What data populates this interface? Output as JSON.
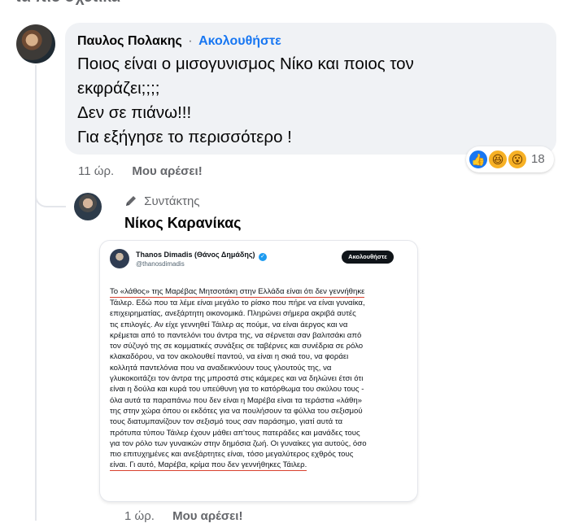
{
  "top_cut_text": "τα πιο σχετικά",
  "comment1": {
    "author": "Παυλος Πολακης",
    "separator": "·",
    "follow_label": "Ακολουθήστε",
    "lines": [
      "Ποιος είναι ο μισογυνισμος Νίκο και ποιος τον",
      "εκφράζει;;;;",
      "Δεν σε πιάνω!!!",
      "Για εξήγησε το περισσότερο !"
    ],
    "reactions": {
      "icons": [
        "like-reaction",
        "haha-reaction",
        "wow-reaction"
      ],
      "count": "18"
    },
    "time": "11 ώρ.",
    "like_label": "Μου αρέσει!"
  },
  "reply": {
    "role": "Συντάκτης",
    "author": "Νίκος Καρανίκας",
    "time": "1 ώρ.",
    "like_label": "Μου αρέσει!",
    "tweet": {
      "name": "Thanos Dimadis (Θάνος Δημάδης)",
      "handle": "@thanosdimadis",
      "follow_label": "Ακολουθήστε",
      "lines": [
        "Το «λάθος» της Μαρέβας Μητσοτάκη στην Ελλάδα είναι ότι δεν γεννήθηκε",
        "Τάιλερ. Εδώ που τα λέμε είναι μεγάλο το ρίσκο που πήρε να είναι γυναίκα,",
        "επιχειρηματίας, ανεξάρτητη οικονομικά. Πληρώνει σήμερα ακριβά αυτές",
        "τις επιλογές. Αν είχε γεννηθεί Τάιλερ ας πούμε, να είναι άεργος και να",
        "κρέμεται από το παντελόνι του άντρα της, να σέρνεται σαν βαλιτσάκι από",
        "τον σύζυγό της σε κομματικές συνάξεις σε ταβέρνες και συνέδρια σε ρόλο",
        "κλακαδόρου, να τον ακολουθεί παντού, να είναι η σκιά του, να φοράει",
        "κολλητά παντελόνια που να αναδεικνύουν τους γλουτούς της, να",
        "γλυκοκοιτάζει τον άντρα της μπροστά στις κάμερες και να δηλώνει έτσι ότι",
        "είναι η δούλα και κυρά του υπεύθυνη για το κατόρθωμα του σκύλου τους -",
        "όλα αυτά τα παραπάνω που δεν είναι η Μαρέβα είναι τα τεράστια «λάθη»",
        "της στην χώρα όπου οι εκδότες για να πουλήσουν τα φύλλα του σεξισμού",
        "τους διατυμπανίζουν τον σεξισμό τους σαν παράσημο, γιατί αυτά τα",
        "πρότυπα τύπου Τάιλερ έχουν μάθει απ'τους πατεράδες και μανάδες τους",
        "για τον ρόλο των γυναικών στην δημόσια ζωή. Οι γυναίκες για αυτούς, όσο",
        "πιο επιτυχημένες και ανεξάρτητες είναι, τόσο μεγαλύτερος εχθρός τους",
        "είναι. Γι αυτό, Μαρέβα, κρίμα που δεν γεννήθηκες Τάιλερ."
      ]
    }
  }
}
